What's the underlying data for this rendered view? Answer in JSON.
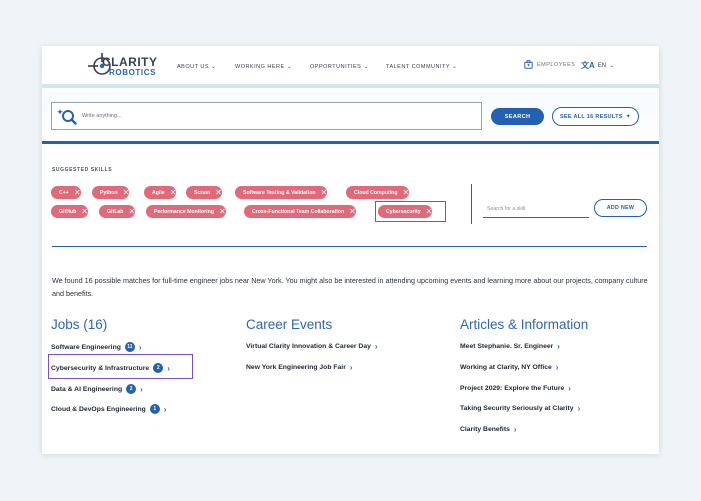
{
  "header": {
    "logo_line1": "CLARITY",
    "logo_line2": "ROBOTICS",
    "nav": [
      "ABOUT US",
      "WORKING HERE",
      "OPPORTUNITIES",
      "TALENT COMMUNITY"
    ],
    "employees": "EMPLOYEES",
    "language": "EN"
  },
  "search": {
    "placeholder": "Write anything...",
    "search_button": "SEARCH",
    "see_all_button": "SEE ALL 16 RESULTS"
  },
  "skills": {
    "label": "SUGGESTED SKILLS",
    "chips": [
      "C++",
      "Python",
      "Agile",
      "Scrum",
      "Software Testing & Validation",
      "Cloud Computing",
      "GitHub",
      "GitLab",
      "Performance Monitoring",
      "Cross-Functional Team Collaboration",
      "Cybersecurity"
    ],
    "input_placeholder": "Search for a skill",
    "add_button": "ADD NEW"
  },
  "intro": "We found 16 possible matches for full-time engineer jobs near New York. You might also be interested in attending upcoming events and learning more about our projects, company culture and benefits.",
  "jobs": {
    "title": "Jobs (16)",
    "items": [
      {
        "label": "Software Engineering",
        "count": "11"
      },
      {
        "label": "Cybersecurity & Infrastructure",
        "count": "2"
      },
      {
        "label": "Data & AI Engineering",
        "count": "2"
      },
      {
        "label": "Cloud & DevOps Engineering",
        "count": "1"
      }
    ]
  },
  "events": {
    "title": "Career Events",
    "items": [
      "Virtual Clarity Innovation & Career Day",
      "New York Engineering Job Fair"
    ]
  },
  "articles": {
    "title": "Articles & Information",
    "items": [
      "Meet Stephanie. Sr. Engineer",
      "Working at Clarity, NY Office",
      "Project 2029: Explore the Future",
      "Taking Security Seriously at Clarity",
      "Clarity Benefits"
    ]
  },
  "colors": {
    "primary": "#2461b2",
    "chip": "#e16a7a",
    "highlight": "#7c4ec9",
    "background": "#eef4f7"
  },
  "icons": [
    "search-sparkle-icon",
    "chevron-down-icon",
    "employees-icon",
    "translate-icon",
    "close-icon",
    "chevron-right-icon"
  ]
}
